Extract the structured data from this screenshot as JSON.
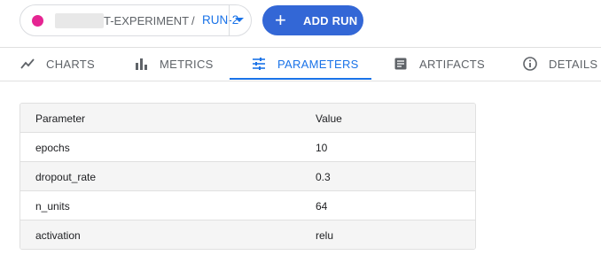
{
  "header": {
    "experiment_name_suffix": "T-EXPERIMENT",
    "separator": "/",
    "run_name": "RUN-2",
    "add_run_label": "ADD RUN",
    "run_color": "#e52592",
    "accent_color": "#1a73e8"
  },
  "tabs": [
    {
      "label": "CHARTS",
      "icon": "line-chart-icon",
      "active": false
    },
    {
      "label": "METRICS",
      "icon": "bar-chart-icon",
      "active": false
    },
    {
      "label": "PARAMETERS",
      "icon": "tune-icon",
      "active": true
    },
    {
      "label": "ARTIFACTS",
      "icon": "article-icon",
      "active": false
    },
    {
      "label": "DETAILS",
      "icon": "info-icon",
      "active": false
    }
  ],
  "table": {
    "columns": [
      "Parameter",
      "Value"
    ],
    "rows": [
      {
        "name": "epochs",
        "value": "10"
      },
      {
        "name": "dropout_rate",
        "value": "0.3"
      },
      {
        "name": "n_units",
        "value": "64"
      },
      {
        "name": "activation",
        "value": "relu"
      }
    ]
  }
}
